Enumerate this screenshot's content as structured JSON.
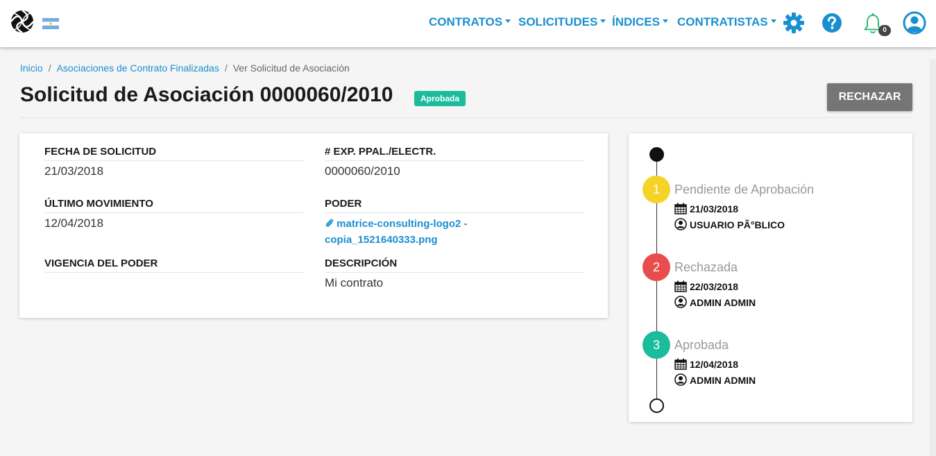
{
  "nav": {
    "items": [
      {
        "label": "CONTRATOS"
      },
      {
        "label": "SOLICITUDES"
      },
      {
        "label": "ÍNDICES"
      },
      {
        "label": "CONTRATISTAS"
      }
    ],
    "notification_count": "0",
    "accent_color": "#1a8fd0"
  },
  "breadcrumb": {
    "home": "Inicio",
    "parent": "Asociaciones de Contrato Finalizadas",
    "current": "Ver Solicitud de Asociación",
    "separator": "/"
  },
  "page": {
    "title": "Solicitud de Asociación 0000060/2010",
    "status": "Aprobada",
    "reject_label": "RECHAZAR"
  },
  "details": {
    "fecha_label": "FECHA DE SOLICITUD",
    "fecha_value": "21/03/2018",
    "exp_label": "# EXP. PPAL./ELECTR.",
    "exp_value": "0000060/2010",
    "ultimo_label": "ÚLTIMO MOVIMIENTO",
    "ultimo_value": "12/04/2018",
    "poder_label": "PODER",
    "poder_file_line1": "matrice-consulting-logo2 -",
    "poder_file_line2": "copia_1521640333.png",
    "vigencia_label": "VIGENCIA DEL PODER",
    "descripcion_label": "DESCRIPCIÓN",
    "descripcion_value": "Mi contrato"
  },
  "timeline": [
    {
      "number": "1",
      "title": "Pendiente de Aprobación",
      "date": "21/03/2018",
      "user": "USUARIO PÃ°BLICO",
      "color": "#f5d327"
    },
    {
      "number": "2",
      "title": "Rechazada",
      "date": "22/03/2018",
      "user": "ADMIN ADMIN",
      "color": "#e84c4c"
    },
    {
      "number": "3",
      "title": "Aprobada",
      "date": "12/04/2018",
      "user": "ADMIN ADMIN",
      "color": "#1abc9c"
    }
  ],
  "icons": {
    "settings": "gear-icon",
    "help": "question-circle-icon",
    "notifications": "bell-icon",
    "user": "user-circle-icon",
    "attachment": "paperclip-icon",
    "date": "calendar-icon",
    "author": "user-circle-icon"
  }
}
